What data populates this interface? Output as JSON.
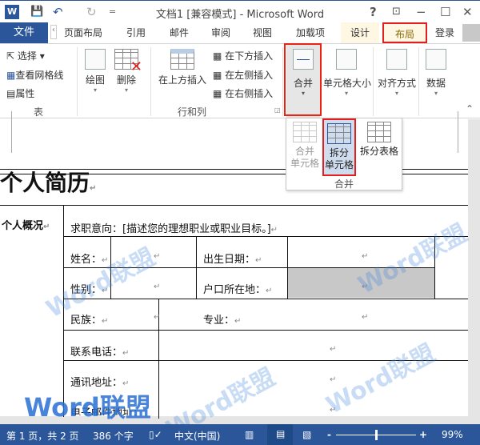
{
  "window": {
    "title": "文档1 [兼容模式] - Microsoft Word",
    "help": "?",
    "restore_ribbon": "⊡",
    "minimize": "−",
    "maximize": "☐",
    "close": "✕"
  },
  "quick_access": {
    "app_icon": "W",
    "save": "💾",
    "undo": "↶",
    "redo": "↻",
    "customize": "="
  },
  "tabs": {
    "file": "文件",
    "items": [
      "页面布局",
      "引用",
      "邮件",
      "审阅",
      "视图",
      "加载项",
      "设计",
      "布局"
    ],
    "login": "登录",
    "active": "布局"
  },
  "ribbon": {
    "table": {
      "select": "选择",
      "gridlines": "查看网格线",
      "properties": "属性",
      "group": "表"
    },
    "draw": "绘图",
    "delete": "删除",
    "rows_cols": {
      "insert_above": "在上方插入",
      "insert_below": "在下方插入",
      "insert_left": "在左侧插入",
      "insert_right": "在右侧插入",
      "group": "行和列"
    },
    "merge": "合并",
    "cell_size": "单元格大小",
    "alignment": "对齐方式",
    "data": "数据"
  },
  "merge_dropdown": {
    "merge_cells": [
      "合并",
      "单元格"
    ],
    "split_cells": [
      "拆分",
      "单元格"
    ],
    "split_table": "拆分表格",
    "group": "合并"
  },
  "document": {
    "heading": "个人简历",
    "section": "个人概况",
    "objective": "求职意向：[描述您的理想职业或职业目标。]",
    "labels": {
      "name": "姓名：",
      "birth": "出生日期：",
      "gender": "性别：",
      "hukou": "户口所在地：",
      "ethnicity": "民族：",
      "major": "专业：",
      "phone": "联系电话：",
      "address": "通讯地址：",
      "email": "电子邮件地址："
    },
    "para_mark": "↵"
  },
  "watermark": "Word联盟",
  "status": {
    "page": "第 1 页，共 2 页",
    "words": "386 个字",
    "language": "中文(中国)",
    "zoom": "99%",
    "zoom_fraction": 0.5,
    "zoom_minus": "-",
    "zoom_plus": "+"
  },
  "colors": {
    "accent": "#2b579a",
    "highlight": "#e21e1e",
    "shaded_cell": "#c8c8c8"
  }
}
